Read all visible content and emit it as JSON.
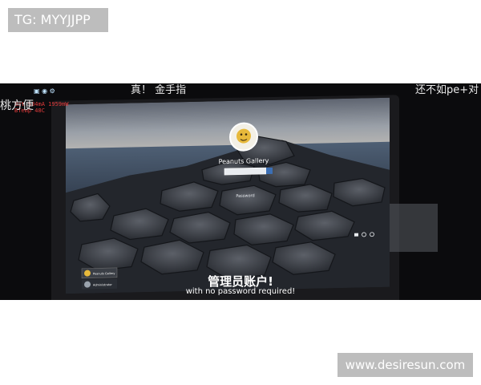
{
  "watermarks": {
    "top_left": "TG: MYYJJPP",
    "bottom_right": "www.desiresun.com"
  },
  "video_overlay": {
    "caption_left": "真！ 金手指",
    "caption_right": "还不如pe+对",
    "caption_left_clip": "桃方便",
    "hud_stats": [
      "Bat  534mA  1959mW",
      "BTemp  48C"
    ]
  },
  "login_screen": {
    "username": "Peanuts Gallery",
    "password_placeholder": "Password",
    "tiles": [
      {
        "label": "Peanuts Gallery"
      },
      {
        "label": "Administrator"
      }
    ]
  },
  "subtitles": {
    "chinese": "管理员账户!",
    "english": "with no password required!"
  },
  "colors": {
    "tag_bg": "#bdbdbd",
    "video_bg": "#0b0b0d",
    "hud_red": "#e23b3b",
    "sky_top": "#8a8f9a",
    "sea": "#3e4f64"
  }
}
